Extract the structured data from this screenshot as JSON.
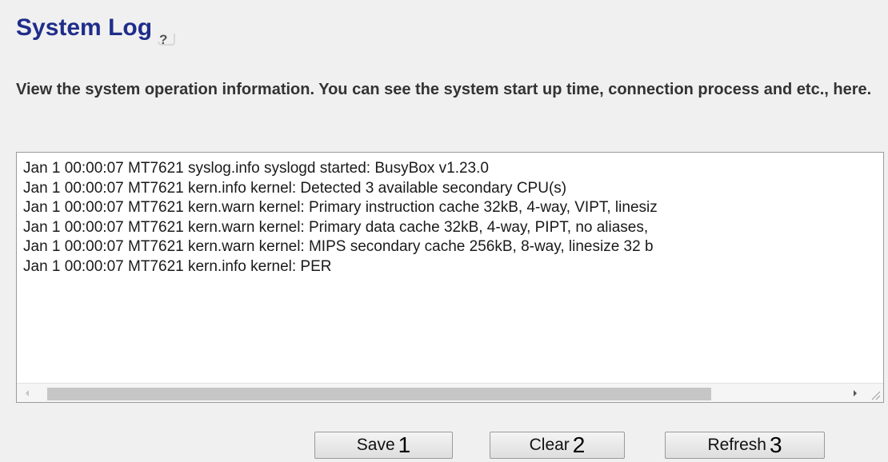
{
  "page": {
    "title": "System Log",
    "description": "View the system operation information. You can see the system start up time, connection process and etc., here."
  },
  "log": {
    "lines": [
      "Jan  1 00:00:07 MT7621 syslog.info syslogd started: BusyBox v1.23.0",
      "Jan  1 00:00:07 MT7621 kern.info kernel: Detected 3 available secondary CPU(s)",
      "Jan  1 00:00:07 MT7621 kern.warn kernel: Primary instruction cache 32kB, 4-way, VIPT, linesiz",
      "Jan  1 00:00:07 MT7621 kern.warn kernel: Primary data cache 32kB, 4-way, PIPT, no aliases,",
      "Jan  1 00:00:07 MT7621 kern.warn kernel: MIPS secondary cache 256kB, 8-way, linesize 32 b",
      "Jan  1 00:00:07 MT7621 kern.info kernel: PER"
    ]
  },
  "buttons": {
    "save": {
      "label": "Save",
      "badge": "1"
    },
    "clear": {
      "label": "Clear",
      "badge": "2"
    },
    "refresh": {
      "label": "Refresh",
      "badge": "3"
    }
  },
  "icons": {
    "help": "help-icon",
    "scroll_left": "scroll-left-arrow-icon",
    "scroll_right": "scroll-right-arrow-icon",
    "resize": "resize-grip-icon"
  },
  "colors": {
    "title": "#1f2d8a",
    "background": "#f0f0f0",
    "log_background": "#ffffff"
  }
}
